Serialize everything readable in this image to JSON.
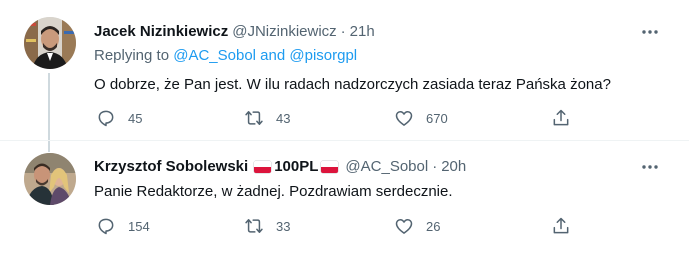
{
  "tweets": [
    {
      "name": "Jacek Nizinkiewicz",
      "handle": "@JNizinkiewicz",
      "dot": "·",
      "time": "21h",
      "replying_prefix": "Replying to ",
      "replying_handle_1": "@AC_Sobol",
      "replying_and": " and ",
      "replying_handle_2": "@pisorgpl",
      "text": "O dobrze, że Pan jest. W ilu radach nadzorczych zasiada teraz Pańska żona?",
      "replies": "45",
      "retweets": "43",
      "likes": "670"
    },
    {
      "name": "Krzysztof Sobolewski",
      "name_suffix": "100PL",
      "handle": "@AC_Sobol",
      "dot": "·",
      "time": "20h",
      "text": "Panie Redaktorze, w żadnej. Pozdrawiam serdecznie.",
      "replies": "154",
      "retweets": "33",
      "likes": "26"
    }
  ],
  "colors": {
    "link": "#1d9bf0",
    "secondary_text": "#536471",
    "flag_red": "#dc143c"
  },
  "icons": [
    "more-icon",
    "reply-icon",
    "retweet-icon",
    "like-icon",
    "share-icon",
    "poland-flag-icon"
  ]
}
